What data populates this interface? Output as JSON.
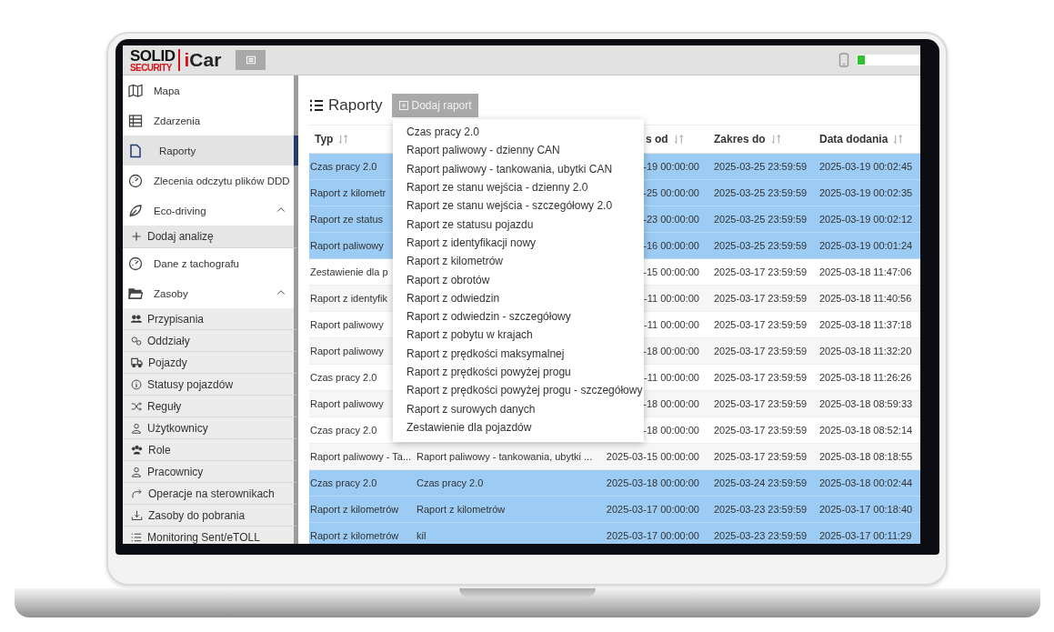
{
  "logo": {
    "top": "SOLID",
    "bottom": "SECURITY",
    "product": "iCar"
  },
  "sidebar": {
    "items": [
      {
        "label": "Mapa",
        "selected": false
      },
      {
        "label": "Zdarzenia",
        "selected": false
      },
      {
        "label": "Raporty",
        "selected": true
      },
      {
        "label": "Zlecenia odczytu plików DDD",
        "selected": false
      },
      {
        "label": "Eco-driving",
        "selected": false,
        "expanded": true,
        "children": [
          {
            "label": "Dodaj analizę",
            "selected": false
          }
        ]
      },
      {
        "label": "Dane z tachografu",
        "selected": false
      },
      {
        "label": "Zasoby",
        "selected": false,
        "expanded": true,
        "children": [
          {
            "label": "Przypisania",
            "selected": false
          },
          {
            "label": "Oddziały",
            "selected": false
          },
          {
            "label": "Pojazdy",
            "selected": false
          },
          {
            "label": "Statusy pojazdów",
            "selected": false
          },
          {
            "label": "Reguły",
            "selected": false
          },
          {
            "label": "Użytkownicy",
            "selected": false
          },
          {
            "label": "Role",
            "selected": false
          },
          {
            "label": "Pracownicy",
            "selected": false
          },
          {
            "label": "Operacje na sterownikach",
            "selected": false
          },
          {
            "label": "Zasoby do pobrania",
            "selected": false
          },
          {
            "label": "Monitoring Sent/eTOLL",
            "selected": false
          }
        ]
      }
    ]
  },
  "page": {
    "title": "Raporty",
    "add_button": "Dodaj raport"
  },
  "add_menu": [
    "Czas pracy 2.0",
    "Raport paliwowy - dzienny CAN",
    "Raport paliwowy - tankowania, ubytki CAN",
    "Raport ze stanu wejścia - dzienny 2.0",
    "Raport ze stanu wejścia - szczegółowy 2.0",
    "Raport ze statusu pojazdu",
    "Raport z identyfikacji nowy",
    "Raport z kilometrów",
    "Raport z obrotów",
    "Raport z odwiedzin",
    "Raport z odwiedzin - szczegółowy",
    "Raport z pobytu w krajach",
    "Raport z prędkości maksymalnej",
    "Raport z prędkości powyżej progu",
    "Raport z prędkości powyżej progu - szczegółowy",
    "Raport z surowych danych",
    "Zestawienie dla pojazdów"
  ],
  "table": {
    "columns": [
      {
        "label": "Typ"
      },
      {},
      {
        "label": "s od"
      },
      {
        "label": "Zakres do"
      },
      {
        "label": "Data dodania"
      }
    ],
    "rows": [
      {
        "cells": [
          "Czas pracy 2.0",
          null,
          "-19 00:00:00",
          "2025-03-25 23:59:59",
          "2025-03-19 00:02:45"
        ],
        "selected": true
      },
      {
        "cells": [
          "Raport z kilometr",
          null,
          "-25 00:00:00",
          "2025-03-25 23:59:59",
          "2025-03-19 00:02:35"
        ],
        "selected": true
      },
      {
        "cells": [
          "Raport ze status",
          null,
          "-23 00:00:00",
          "2025-03-25 23:59:59",
          "2025-03-19 00:02:12"
        ],
        "selected": true
      },
      {
        "cells": [
          "Raport paliwowy",
          null,
          "-16 00:00:00",
          "2025-03-25 23:59:59",
          "2025-03-19 00:01:24"
        ],
        "selected": true
      },
      {
        "cells": [
          "Zestawienie dla p",
          null,
          "-15 00:00:00",
          "2025-03-17 23:59:59",
          "2025-03-18 11:47:06"
        ],
        "selected": false
      },
      {
        "cells": [
          "Raport z identyfik",
          null,
          "-11 00:00:00",
          "2025-03-17 23:59:59",
          "2025-03-18 11:40:56"
        ],
        "selected": false
      },
      {
        "cells": [
          "Raport paliwowy",
          null,
          "-11 00:00:00",
          "2025-03-17 23:59:59",
          "2025-03-18 11:37:18"
        ],
        "selected": false
      },
      {
        "cells": [
          "Raport paliwowy",
          null,
          "-18 00:00:00",
          "2025-03-17 23:59:59",
          "2025-03-18 11:32:20"
        ],
        "selected": false
      },
      {
        "cells": [
          "Czas pracy 2.0",
          null,
          "-11 00:00:00",
          "2025-03-17 23:59:59",
          "2025-03-18 11:26:26"
        ],
        "selected": false
      },
      {
        "cells": [
          "Raport paliwowy",
          null,
          "-18 00:00:00",
          "2025-03-17 23:59:59",
          "2025-03-18 08:59:33"
        ],
        "selected": false
      },
      {
        "cells": [
          "Czas pracy 2.0",
          null,
          "-18 00:00:00",
          "2025-03-17 23:59:59",
          "2025-03-18 08:52:14"
        ],
        "selected": false
      },
      {
        "cells": [
          "Raport paliwowy - Ta...",
          "Raport paliwowy - tankowania, ubytki ...",
          "2025-03-15 00:00:00",
          "2025-03-17 23:59:59",
          "2025-03-18 08:18:55"
        ],
        "selected": false
      },
      {
        "cells": [
          "Czas pracy 2.0",
          "Czas pracy 2.0",
          "2025-03-18 00:00:00",
          "2025-03-24 23:59:59",
          "2025-03-18 00:02:44"
        ],
        "selected": true
      },
      {
        "cells": [
          "Raport z kilometrów",
          "Raport z kilometrów",
          "2025-03-17 00:00:00",
          "2025-03-23 23:59:59",
          "2025-03-17 00:18:40"
        ],
        "selected": true
      },
      {
        "cells": [
          "Raport z kilometrów",
          "kil",
          "2025-03-17 00:00:00",
          "2025-03-23 23:59:59",
          "2025-03-17 00:11:29"
        ],
        "selected": true
      }
    ]
  }
}
